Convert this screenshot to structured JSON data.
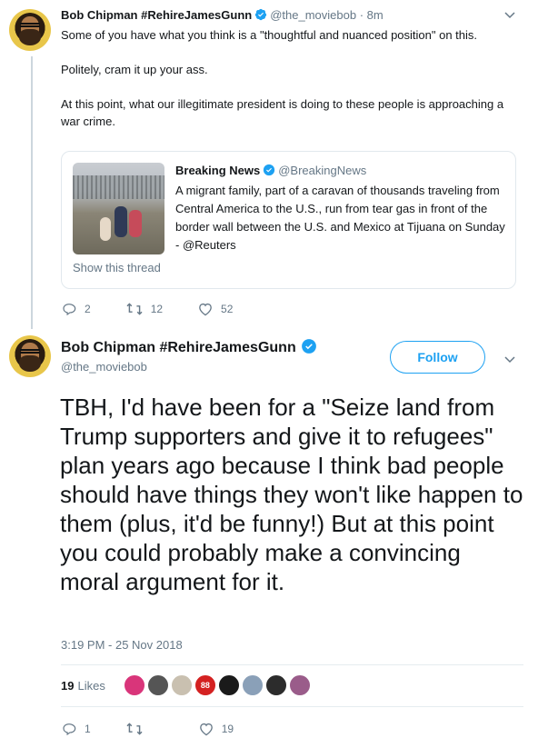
{
  "tweet1": {
    "name": "Bob Chipman #RehireJamesGunn",
    "handle": "@the_moviebob",
    "time": "· 8m",
    "paragraphs": [
      "Some of you have what you think is a \"thoughtful and nuanced position\" on this.",
      "Politely, cram it up your ass.",
      "At this point, what our illegitimate president is doing to these people is approaching a war crime."
    ],
    "quote": {
      "name": "Breaking News",
      "handle": "@BreakingNews",
      "text": "A migrant family, part of a caravan of thousands traveling from Central America to the U.S., run from tear gas in front of the border wall between the U.S. and Mexico at Tijuana on Sunday - @Reuters",
      "link": "Show this thread"
    },
    "actions": {
      "replies": "2",
      "retweets": "12",
      "likes": "52"
    }
  },
  "tweet2": {
    "name": "Bob Chipman #RehireJamesGunn",
    "handle": "@the_moviebob",
    "follow_label": "Follow",
    "text": "TBH, I'd have been for a \"Seize land from Trump supporters and give it to refugees\" plan years ago because I think bad people should have things they won't like happen to them (plus, it'd be funny!) But at this point you could probably make a convincing moral argument for it.",
    "timestamp": "3:19 PM - 25 Nov 2018",
    "likes_count": "19",
    "likes_label": "Likes",
    "actions": {
      "replies": "1",
      "retweets": "",
      "likes": "19"
    }
  },
  "likers": [
    {
      "color": "#d9357a",
      "mark": ""
    },
    {
      "color": "#555555",
      "mark": ""
    },
    {
      "color": "#c9c0b0",
      "mark": ""
    },
    {
      "color": "#d42121",
      "mark": "88"
    },
    {
      "color": "#1a1a1a",
      "mark": ""
    },
    {
      "color": "#8aa0b8",
      "mark": ""
    },
    {
      "color": "#2c2c2c",
      "mark": ""
    },
    {
      "color": "#9a5c8a",
      "mark": ""
    }
  ],
  "colors": {
    "accent": "#1da1f2",
    "muted": "#657786",
    "text": "#14171a"
  },
  "icons": [
    "reply-icon",
    "retweet-icon",
    "like-icon",
    "verified-badge-icon",
    "chevron-down-icon"
  ]
}
